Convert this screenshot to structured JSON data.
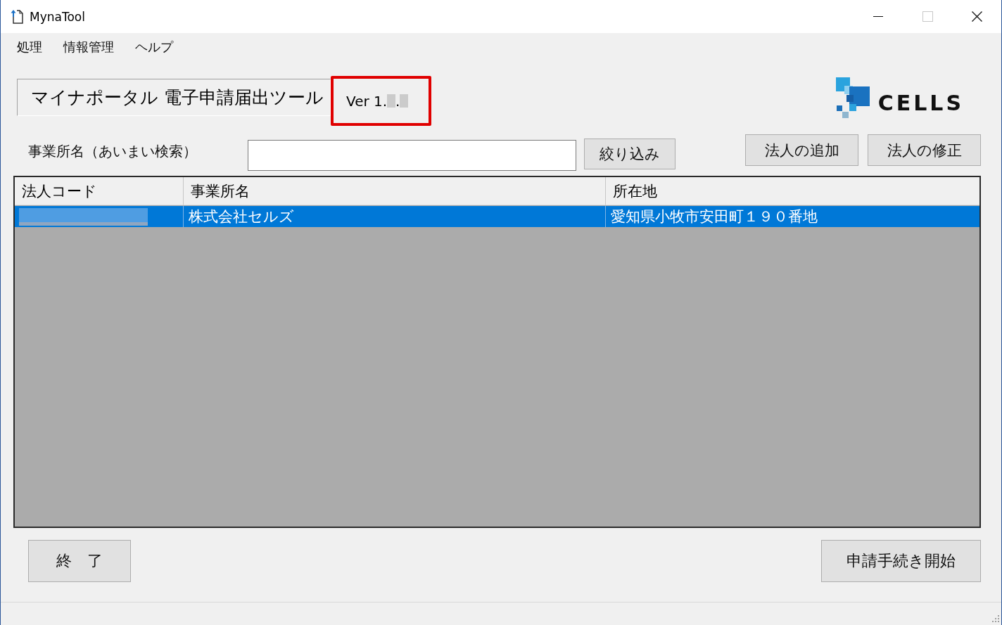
{
  "window": {
    "title": "MynaTool",
    "maximize_disabled": true
  },
  "menu": [
    {
      "label": "処理"
    },
    {
      "label": "情報管理"
    },
    {
      "label": "ヘルプ"
    }
  ],
  "header": {
    "title": "マイナポータル 電子申請届出ツール",
    "version": {
      "highlighted": true,
      "segments": [
        {
          "kind": "text",
          "text": "Ver 1."
        },
        {
          "kind": "redacted"
        },
        {
          "kind": "text",
          "text": "."
        },
        {
          "kind": "redacted"
        }
      ]
    },
    "logo": {
      "text": "CELLS"
    }
  },
  "search": {
    "label": "事業所名（あいまい検索）",
    "button": "絞り込み"
  },
  "actions": [
    {
      "label": "法人の追加"
    },
    {
      "label": "法人の修正"
    }
  ],
  "table": {
    "columns": [
      "法人コード",
      "事業所名",
      "所在地"
    ],
    "rows": [
      {
        "selected": true,
        "cells": [
          {
            "kind": "redacted"
          },
          {
            "kind": "text",
            "text": "株式会社セルズ"
          },
          {
            "kind": "text",
            "text": "愛知県小牧市安田町１９０番地"
          }
        ]
      }
    ]
  },
  "footer_buttons": [
    {
      "label": "終　了"
    },
    {
      "label": "申請手続き開始"
    }
  ]
}
